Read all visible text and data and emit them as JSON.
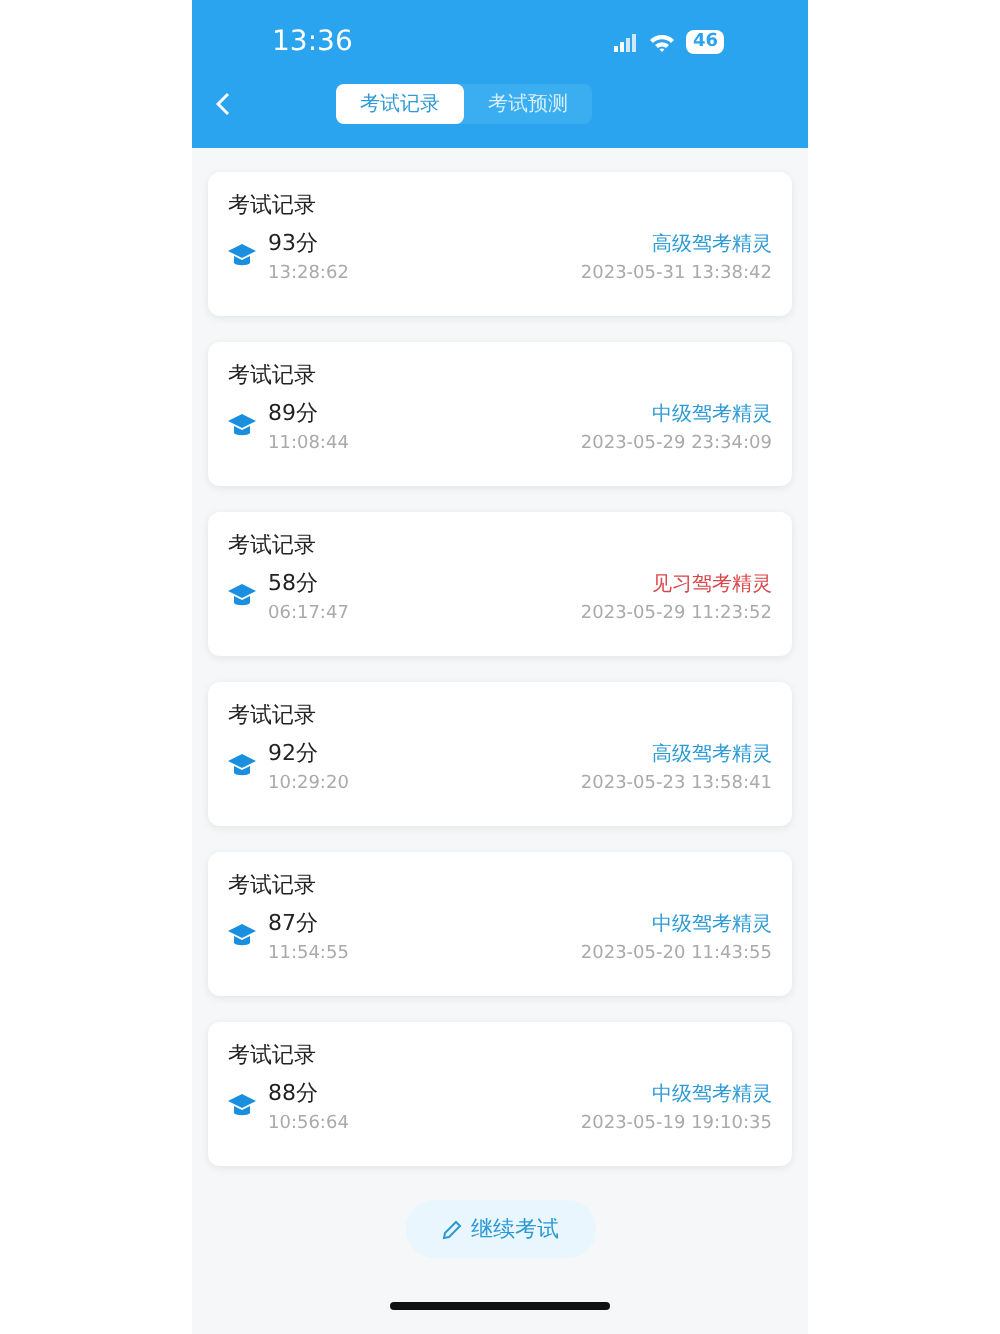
{
  "status_bar": {
    "time": "13:36",
    "battery": "46"
  },
  "tabs": [
    {
      "label": "考试记录",
      "selected": true
    },
    {
      "label": "考试预测",
      "selected": false
    }
  ],
  "records": [
    {
      "title": "考试记录",
      "score": "93分",
      "duration": "13:28:62",
      "level": "高级驾考精灵",
      "color": "#2b9ad6",
      "date": "2023-05-31 13:38:42"
    },
    {
      "title": "考试记录",
      "score": "89分",
      "duration": "11:08:44",
      "level": "中级驾考精灵",
      "color": "#2b9ad6",
      "date": "2023-05-29 23:34:09"
    },
    {
      "title": "考试记录",
      "score": "58分",
      "duration": "06:17:47",
      "level": "见习驾考精灵",
      "color": "#d9474b",
      "date": "2023-05-29 11:23:52"
    },
    {
      "title": "考试记录",
      "score": "92分",
      "duration": "10:29:20",
      "level": "高级驾考精灵",
      "color": "#2b9ad6",
      "date": "2023-05-23 13:58:41"
    },
    {
      "title": "考试记录",
      "score": "87分",
      "duration": "11:54:55",
      "level": "中级驾考精灵",
      "color": "#2b9ad6",
      "date": "2023-05-20 11:43:55"
    },
    {
      "title": "考试记录",
      "score": "88分",
      "duration": "10:56:64",
      "level": "中级驾考精灵",
      "color": "#2b9ad6",
      "date": "2023-05-19 19:10:35"
    }
  ],
  "continue_button": {
    "label": "继续考试"
  }
}
